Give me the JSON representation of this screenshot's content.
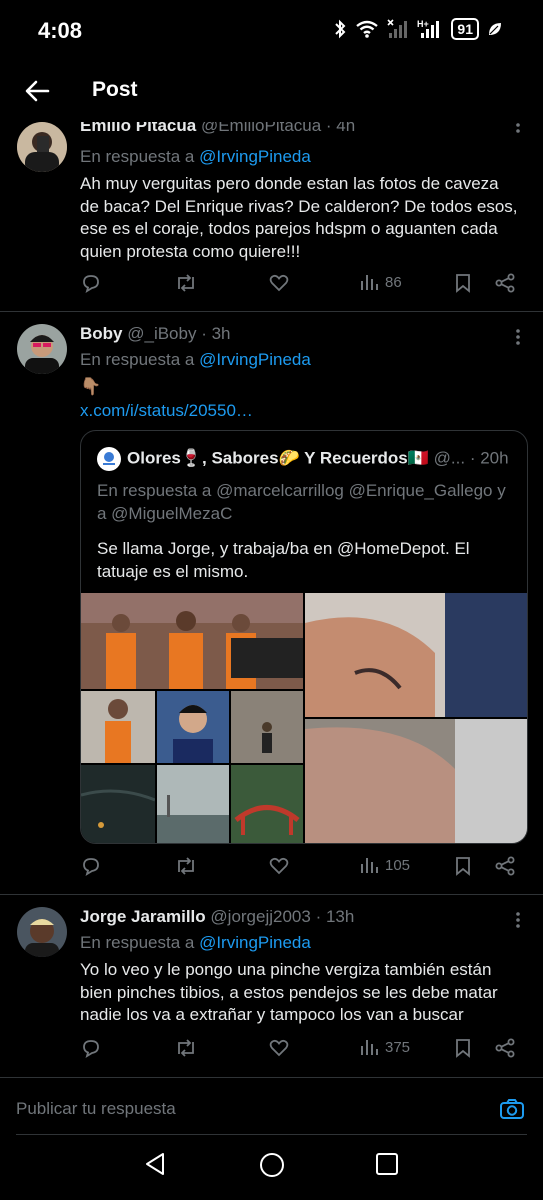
{
  "status": {
    "time": "4:08",
    "battery": "91"
  },
  "topbar": {
    "title": "Post"
  },
  "tweets": [
    {
      "name": "Emilio Pitacua",
      "handle": "@EmilioPitacua",
      "time": "· 4h",
      "reply_prefix": "En respuesta a ",
      "reply_to": "@IrvingPineda",
      "text": "Ah muy verguitas pero donde estan las fotos de caveza de baca? Del Enrique rivas? De calderon? De todos esos, ese es el coraje, todos parejos hdspm o aguanten cada quien protesta como quiere!!!",
      "views": "86"
    },
    {
      "name": "Boby",
      "handle": "@_iBoby",
      "time": "· 3h",
      "reply_prefix": "En respuesta a ",
      "reply_to": "@IrvingPineda",
      "emoji": "👇🏽",
      "link": "x.com/i/status/20550…",
      "views": "105",
      "quote": {
        "name": "Olores🍷, Sabores🌮 Y Recuerdos🇲🇽",
        "handle": "@...",
        "time": "· 20h",
        "reply": "En respuesta a @marcelcarrillog @Enrique_Gallego y a @MiguelMezaC",
        "text": "Se llama Jorge, y trabaja/ba en @HomeDepot. El tatuaje es el mismo."
      }
    },
    {
      "name": "Jorge Jaramillo",
      "handle": "@jorgejj2003",
      "time": "· 13h",
      "reply_prefix": "En respuesta a ",
      "reply_to": "@IrvingPineda",
      "text": "Yo lo veo y le pongo una pinche vergiza también están bien pinches tibios, a estos pendejos se les debe matar nadie los va a extrañar y tampoco los van a buscar",
      "views": "375"
    }
  ],
  "compose": {
    "placeholder": "Publicar tu respuesta"
  },
  "colors": {
    "accent": "#1d9bf0",
    "muted": "#71767b",
    "text": "#e7e9ea",
    "border": "#2f3336"
  },
  "icons": [
    "back-arrow-icon",
    "more-icon",
    "reply-icon",
    "retweet-icon",
    "like-icon",
    "views-icon",
    "bookmark-icon",
    "share-icon",
    "camera-icon",
    "nav-back-icon",
    "nav-home-icon",
    "nav-recents-icon"
  ]
}
